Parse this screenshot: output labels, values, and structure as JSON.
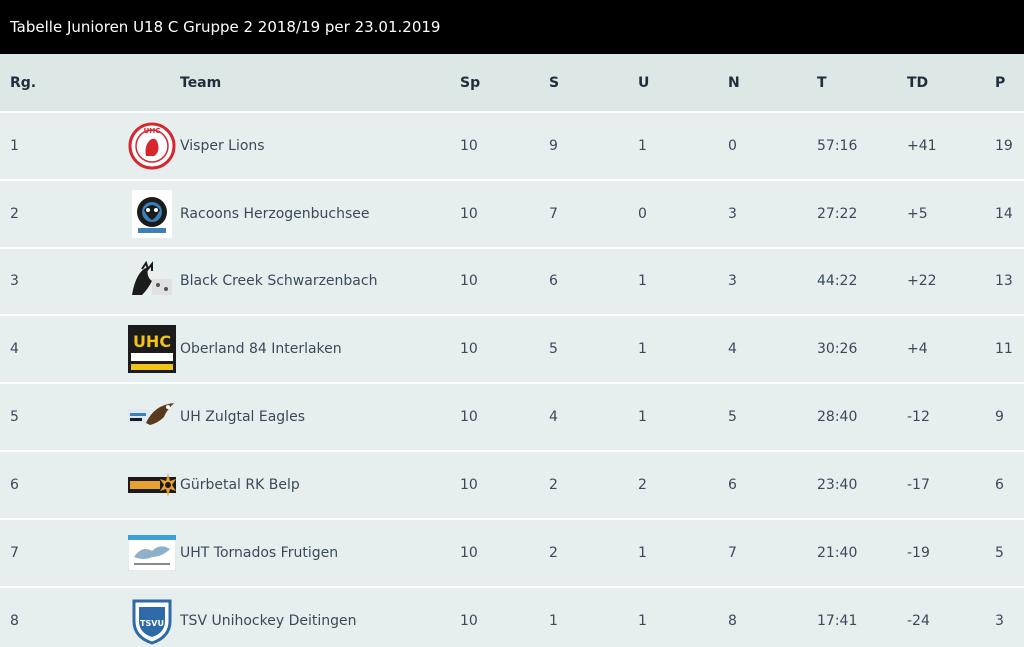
{
  "title": "Tabelle Junioren U18 C Gruppe 2 2018/19 per 23.01.2019",
  "headers": {
    "rank": "Rg.",
    "team": "Team",
    "sp": "Sp",
    "s": "S",
    "u": "U",
    "n": "N",
    "t": "T",
    "td": "TD",
    "p": "P"
  },
  "rows": [
    {
      "rank": "1",
      "team": "Visper Lions",
      "logo": "visper-lions-logo",
      "logo_text": "UHC",
      "sp": "10",
      "s": "9",
      "u": "1",
      "n": "0",
      "t": "57:16",
      "td": "+41",
      "p": "19"
    },
    {
      "rank": "2",
      "team": "Racoons Herzogenbuchsee",
      "logo": "racoons-logo",
      "logo_text": "",
      "sp": "10",
      "s": "7",
      "u": "0",
      "n": "3",
      "t": "27:22",
      "td": "+5",
      "p": "14"
    },
    {
      "rank": "3",
      "team": "Black Creek Schwarzenbach",
      "logo": "black-creek-logo",
      "logo_text": "",
      "sp": "10",
      "s": "6",
      "u": "1",
      "n": "3",
      "t": "44:22",
      "td": "+22",
      "p": "13"
    },
    {
      "rank": "4",
      "team": "Oberland 84 Interlaken",
      "logo": "oberland-logo",
      "logo_text": "UHC",
      "sp": "10",
      "s": "5",
      "u": "1",
      "n": "4",
      "t": "30:26",
      "td": "+4",
      "p": "11"
    },
    {
      "rank": "5",
      "team": "UH Zulgtal Eagles",
      "logo": "zulgtal-eagles-logo",
      "logo_text": "",
      "sp": "10",
      "s": "4",
      "u": "1",
      "n": "5",
      "t": "28:40",
      "td": "-12",
      "p": "9"
    },
    {
      "rank": "6",
      "team": "Gürbetal RK Belp",
      "logo": "guerbetal-logo",
      "logo_text": "",
      "sp": "10",
      "s": "2",
      "u": "2",
      "n": "6",
      "t": "23:40",
      "td": "-17",
      "p": "6"
    },
    {
      "rank": "7",
      "team": "UHT Tornados Frutigen",
      "logo": "tornados-logo",
      "logo_text": "",
      "sp": "10",
      "s": "2",
      "u": "1",
      "n": "7",
      "t": "21:40",
      "td": "-19",
      "p": "5"
    },
    {
      "rank": "8",
      "team": "TSV Unihockey Deitingen",
      "logo": "deitingen-logo",
      "logo_text": "TSVU",
      "sp": "10",
      "s": "1",
      "u": "1",
      "n": "8",
      "t": "17:41",
      "td": "-24",
      "p": "3"
    }
  ],
  "colors": {
    "title_bg": "#000000",
    "header_bg": "#dde7e6",
    "row_bg": "#e7efee",
    "text": "#3a4a5a"
  }
}
